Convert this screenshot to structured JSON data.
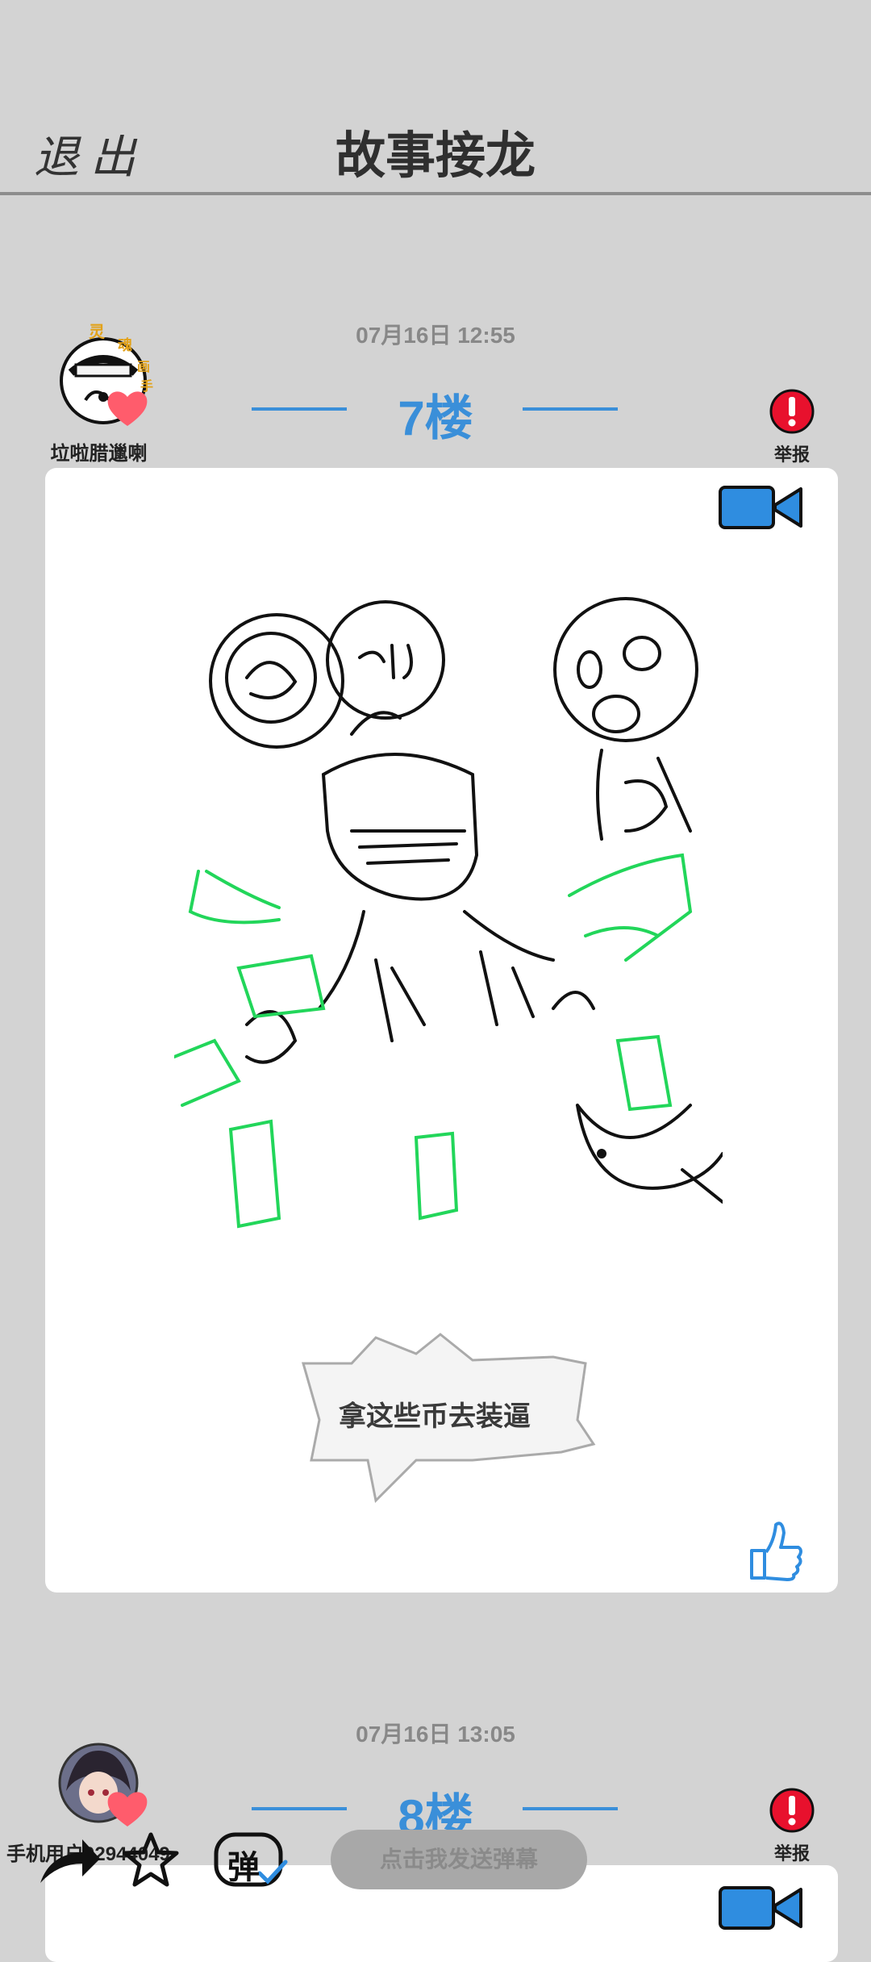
{
  "header": {
    "exit_label": "退出",
    "title": "故事接龙"
  },
  "posts": [
    {
      "timestamp": "07月16日  12:55",
      "floor": "7楼",
      "username": "垃啦腊邋喇",
      "report_label": "举报",
      "caption": "拿这些币去装逼"
    },
    {
      "timestamp": "07月16日  13:05",
      "floor": "8楼",
      "username": "手机用户02944049",
      "report_label": "举报"
    }
  ],
  "bottom_bar": {
    "danmaku_placeholder": "点击我发送弹幕",
    "danmaku_icon_label": "弹"
  },
  "colors": {
    "accent": "#3a8fd9",
    "background": "#d3d3d3",
    "report": "#e8112d",
    "heart": "#ff5c6c",
    "green_ink": "#22d65a"
  }
}
